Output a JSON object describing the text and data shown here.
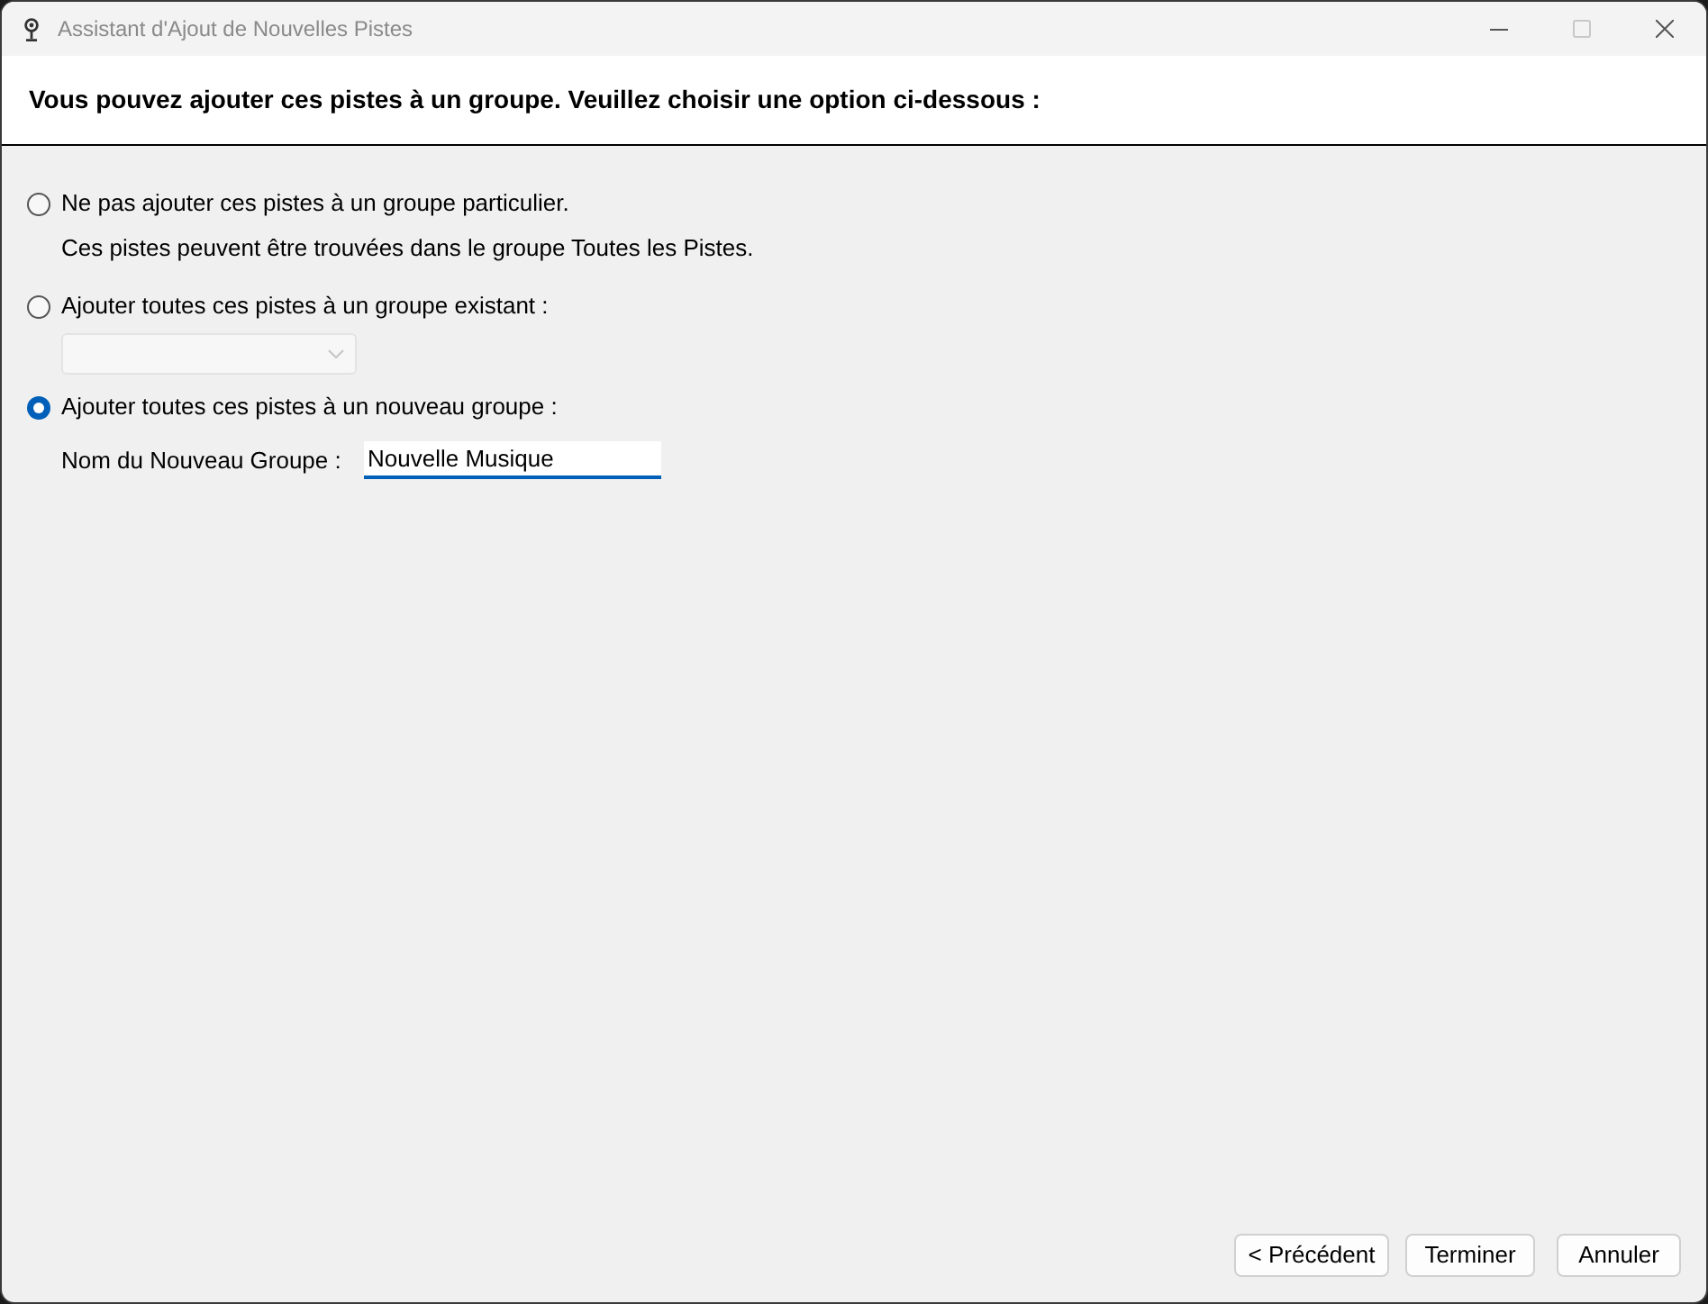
{
  "window": {
    "title": "Assistant d'Ajout de Nouvelles Pistes",
    "maximize_button": {
      "disabled": true
    }
  },
  "header": {
    "text": "Vous pouvez ajouter ces pistes à un groupe. Veuillez choisir une option ci-dessous :"
  },
  "options": [
    {
      "kind": "note",
      "label": "Ne pas ajouter ces pistes à un groupe particulier.",
      "selected": false,
      "note": "Ces pistes peuvent être trouvées dans le groupe Toutes les Pistes."
    },
    {
      "kind": "dropdown",
      "label": "Ajouter toutes ces pistes à un groupe existant :",
      "selected": false,
      "dropdown": {
        "disabled": true
      }
    },
    {
      "kind": "field",
      "label": "Ajouter toutes ces pistes à un nouveau groupe :",
      "selected": true,
      "field_label": "Nom du Nouveau Groupe :",
      "value": "Nouvelle Musique"
    }
  ],
  "buttons": [
    {
      "label": "< Précédent"
    },
    {
      "label": "Terminer"
    },
    {
      "label": "Annuler"
    }
  ]
}
